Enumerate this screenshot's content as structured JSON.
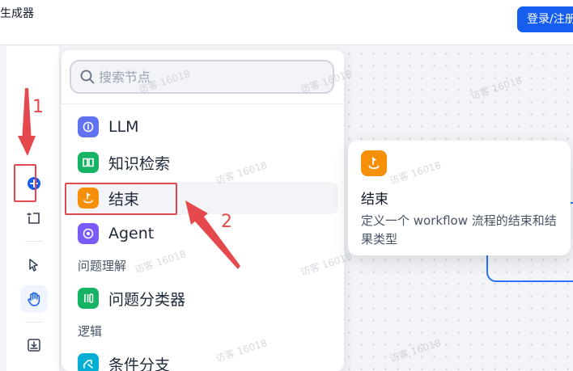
{
  "app": {
    "title": "生成器"
  },
  "header": {
    "login_label": "登录/注册"
  },
  "search": {
    "placeholder": "搜索节点"
  },
  "nodes": [
    {
      "label": "LLM",
      "icon": "llm-icon",
      "color": "#6172f3"
    },
    {
      "label": "知识检索",
      "icon": "knowledge-retrieval-icon",
      "color": "#16b364"
    },
    {
      "label": "结束",
      "icon": "end-icon",
      "color": "#f79009"
    },
    {
      "label": "Agent",
      "icon": "agent-icon",
      "color": "#7a5af8"
    },
    {
      "label": "问题分类器",
      "icon": "question-classifier-icon",
      "color": "#16b364"
    },
    {
      "label": "条件分支",
      "icon": "if-else-icon",
      "color": "#06aed4"
    }
  ],
  "groups": {
    "question_understanding": "问题理解",
    "logic": "逻辑"
  },
  "tooltip": {
    "title": "结束",
    "description": "定义一个 workflow 流程的结束和结果类型"
  },
  "annotations": {
    "step1": "1",
    "step2": "2",
    "color": "#e5484d"
  },
  "watermark": "访客 16018"
}
